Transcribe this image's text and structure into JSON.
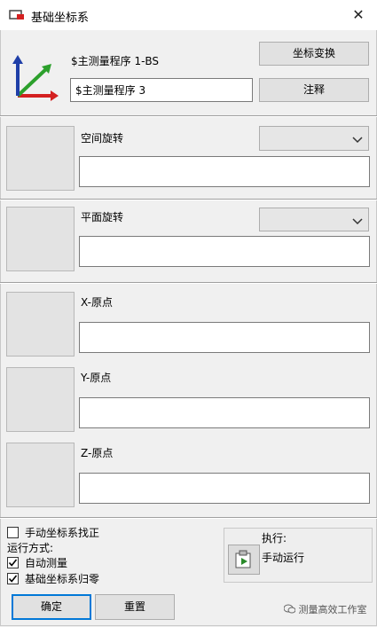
{
  "window": {
    "title": "基础坐标系",
    "close_glyph": "✕"
  },
  "header": {
    "program_label": "$主测量程序 1-BS",
    "program_input": "$主测量程序 3",
    "transform_button": "坐标变换",
    "comment_button": "注释"
  },
  "rotation": {
    "space_label": "空间旋转",
    "space_input": "",
    "plane_label": "平面旋转",
    "plane_input": ""
  },
  "origins": {
    "x_label": "X-原点",
    "x_input": "",
    "y_label": "Y-原点",
    "y_input": "",
    "z_label": "Z-原点",
    "z_input": ""
  },
  "options": {
    "manual_label": "手动坐标系找正",
    "manual_checked": false,
    "run_mode_label": "运行方式:",
    "auto_label": "自动测量",
    "auto_checked": true,
    "reset_label": "基础坐标系归零",
    "reset_checked": true
  },
  "execute": {
    "label": "执行:",
    "value": "手动运行"
  },
  "footer": {
    "ok_button": "确定",
    "reset_button": "重置"
  },
  "watermark": "测量高效工作室",
  "colors": {
    "accent": "#0078d7",
    "axis_x": "#d42020",
    "axis_y": "#2ca02c",
    "axis_z": "#1f3fa8"
  }
}
